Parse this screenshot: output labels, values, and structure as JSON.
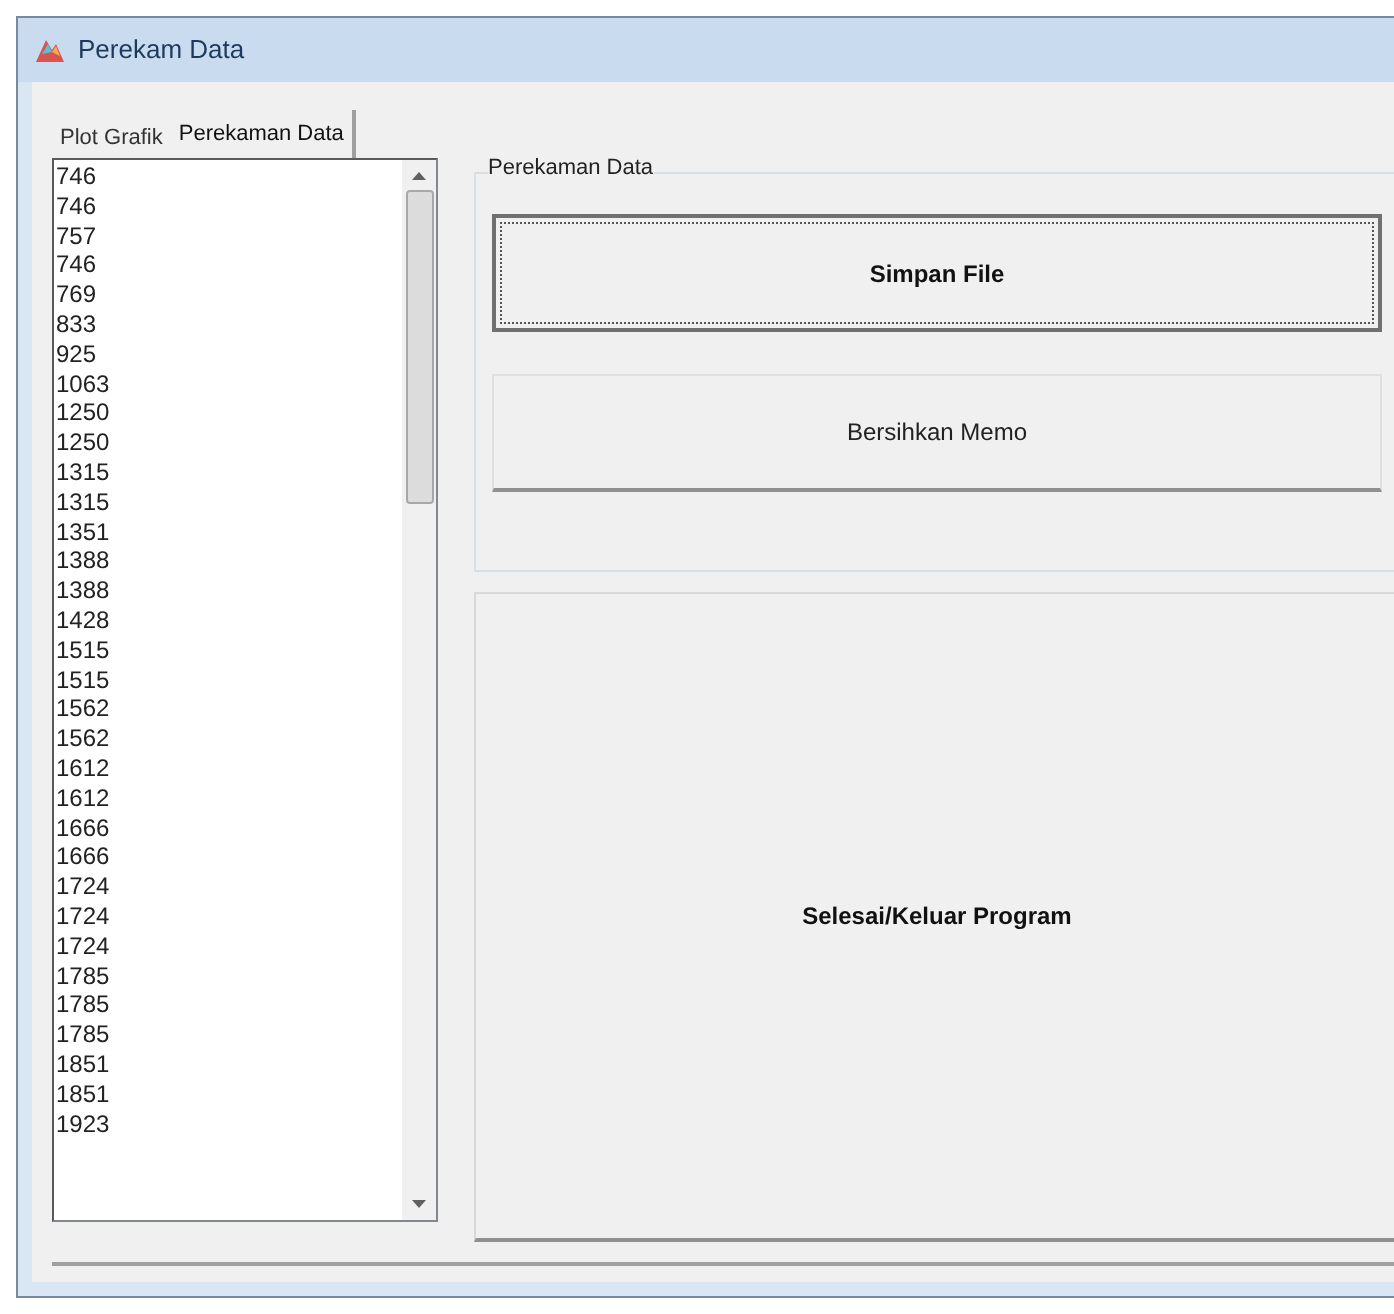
{
  "window": {
    "title": "Perekam Data"
  },
  "tabs": [
    {
      "label": "Plot Grafik",
      "selected": false
    },
    {
      "label": "Perekaman Data",
      "selected": true
    }
  ],
  "memo": {
    "lines": [
      "746",
      "746",
      "757",
      "746",
      "769",
      "833",
      "925",
      "1063",
      "1250",
      "1250",
      "1315",
      "1315",
      "1351",
      "1388",
      "1388",
      "1428",
      "1515",
      "1515",
      "1562",
      "1562",
      "1612",
      "1612",
      "1666",
      "1666",
      "1724",
      "1724",
      "1724",
      "1785",
      "1785",
      "1785",
      "1851",
      "1851",
      "1923"
    ]
  },
  "group": {
    "title": "Perekaman Data",
    "buttons": [
      {
        "label": "Simpan File",
        "focused": true
      },
      {
        "label": "Bersihkan Memo",
        "focused": false
      }
    ]
  },
  "exit_button": {
    "label": "Selesai/Keluar Program"
  }
}
